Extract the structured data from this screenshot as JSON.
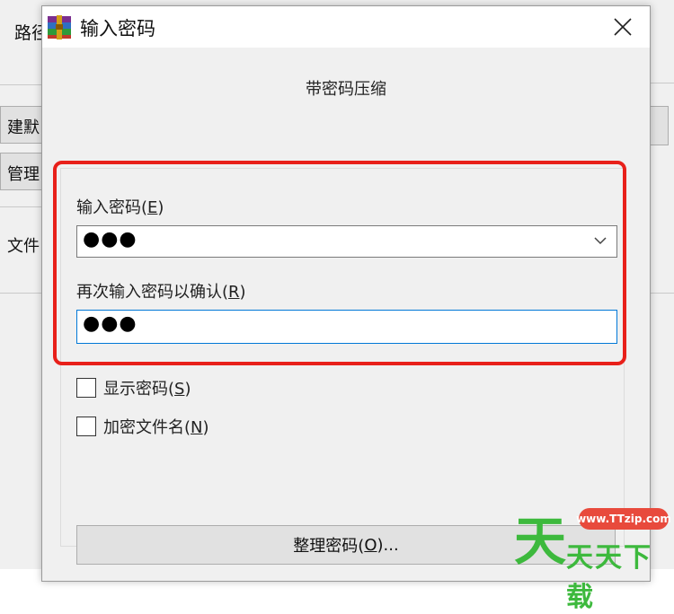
{
  "background": {
    "label1": "路径",
    "label2": "建默",
    "label3": "管理",
    "label4": "文件"
  },
  "dialog": {
    "title": "输入密码",
    "subtitle": "带密码压缩",
    "enter_password_label": "输入密码(",
    "enter_password_key": "E",
    "enter_password_suffix": ")",
    "password_value": "●●●",
    "confirm_label": "再次输入密码以确认(",
    "confirm_key": "R",
    "confirm_suffix": ")",
    "confirm_value": "●●●",
    "show_password_label": "显示密码(",
    "show_password_key": "S",
    "show_password_suffix": ")",
    "encrypt_names_label": "加密文件名(",
    "encrypt_names_key": "N",
    "encrypt_names_suffix": ")",
    "organize_label": "整理密码(",
    "organize_key": "O",
    "organize_suffix": ")..."
  },
  "watermark": {
    "big": "天",
    "url": "www.TTzip.com",
    "text": "天天下载"
  },
  "colors": {
    "highlight": "#e8201a",
    "focus": "#0078d7",
    "watermark_green": "#3db93d",
    "watermark_red": "#e84a3c"
  }
}
